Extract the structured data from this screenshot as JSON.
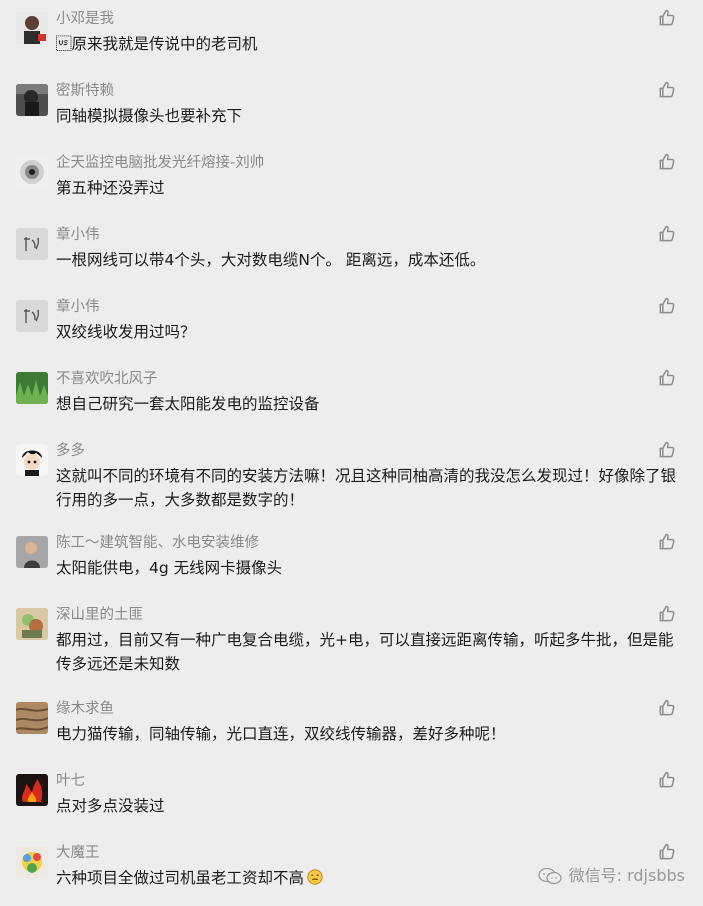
{
  "comments": [
    {
      "name": "小邓是我",
      "text": "\u001f原来我就是传说中的老司机",
      "avatar": "avatar-person-photo",
      "colors": {
        "avatar": "#6c6c6c"
      }
    },
    {
      "name": "密斯特赖",
      "text": "同轴模拟摄像头也要补充下",
      "avatar": "avatar-person-dark",
      "colors": {
        "avatar": "#3d3d3d"
      }
    },
    {
      "name": "企天监控电脑批发光纤熔接-刘帅",
      "text": "第五种还没弄过",
      "avatar": "avatar-shop-logo",
      "colors": {
        "avatar": "#c8c8c8"
      }
    },
    {
      "name": "章小伟",
      "text": "一根网线可以带4个头，大对数电缆N个。 距离远，成本还低。",
      "avatar": "avatar-calligraphy",
      "colors": {
        "avatar": "#d6d6d6"
      }
    },
    {
      "name": "章小伟",
      "text": "双绞线收发用过吗？",
      "avatar": "avatar-calligraphy",
      "colors": {
        "avatar": "#d6d6d6"
      }
    },
    {
      "name": "不喜欢吹北风子",
      "text": "想自己研究一套太阳能发电的监控设备",
      "avatar": "avatar-grass",
      "colors": {
        "avatar": "#3f8a3a"
      }
    },
    {
      "name": "多多",
      "text": "这就叫不同的环境有不同的安装方法嘛！况且这种同柚高清的我没怎么发现过！好像除了银行用的多一点，大多数都是数字的！",
      "avatar": "avatar-cartoon-boy",
      "colors": {
        "avatar": "#f4f4f4"
      }
    },
    {
      "name": "陈工～建筑智能、水电安装维修",
      "text": "太阳能供电，4g 无线网卡摄像头",
      "avatar": "avatar-man-photo",
      "colors": {
        "avatar": "#8b8b8b"
      }
    },
    {
      "name": "深山里的土匪",
      "text": "都用过，目前又有一种广电复合电缆，光+电，可以直接远距离传输，听起多牛批，但是能传多远还是未知数",
      "avatar": "avatar-character-art",
      "colors": {
        "avatar": "#bca680"
      }
    },
    {
      "name": "缘木求鱼",
      "text": "电力猫传输，同轴传输，光口直连，双绞线传输器，差好多种呢！",
      "avatar": "avatar-wood",
      "colors": {
        "avatar": "#8d6a49"
      }
    },
    {
      "name": "叶七",
      "text": "点对多点没装过",
      "avatar": "avatar-red-fire",
      "colors": {
        "avatar": "#b1231d"
      }
    },
    {
      "name": "大魔王",
      "text": "六种项目全做过司机虽老工资却不高",
      "avatar": "avatar-colorful-cartoon",
      "colors": {
        "avatar": "#d9d1c7"
      },
      "emoji": "embarrassed-emoji"
    }
  ],
  "watermark": {
    "label": "微信号: rdjsbbs",
    "icon": "wechat-icon"
  },
  "colors": {
    "background": "#ededed",
    "name": "#8a8a8a",
    "text": "#1b1b1b",
    "like": "#8d8d8d"
  }
}
